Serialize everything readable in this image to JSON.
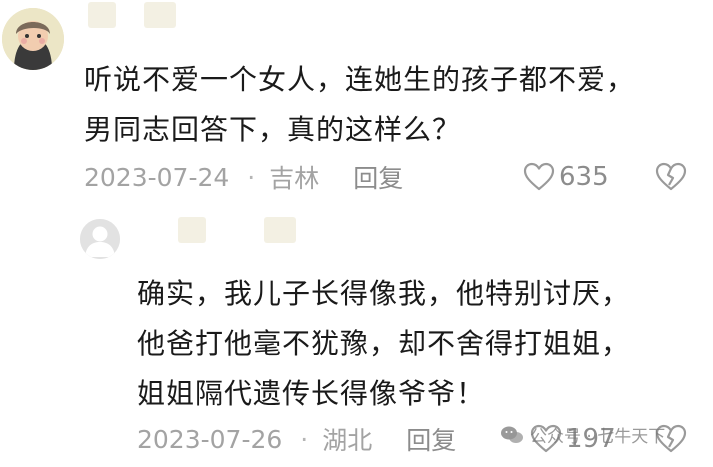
{
  "comments": [
    {
      "avatar": "cartoon-avatar",
      "text_lines": [
        "听说不爱一个女人，连她生的孩子都不爱，",
        "男同志回答下，真的这样么？"
      ],
      "date": "2023-07-24",
      "separator": "·",
      "location": "吉林",
      "reply_label": "回复",
      "like_count": "635",
      "icons": {
        "like": "heart-outline-icon",
        "dislike": "broken-heart-icon"
      }
    },
    {
      "avatar": "default-gray-avatar",
      "text_lines": [
        "确实，我儿子长得像我，他特别讨厌，",
        "他爸打他毫不犹豫，却不舍得打姐姐，",
        "姐姐隔代遗传长得像爷爷！"
      ],
      "date": "2023-07-26",
      "separator": "·",
      "location": "湖北",
      "reply_label": "回复",
      "like_count": "197",
      "icons": {
        "like": "heart-outline-icon",
        "dislike": "broken-heart-icon"
      }
    }
  ],
  "watermark": {
    "icon": "wechat-icon",
    "text": "公众号 · 七牛天下"
  }
}
